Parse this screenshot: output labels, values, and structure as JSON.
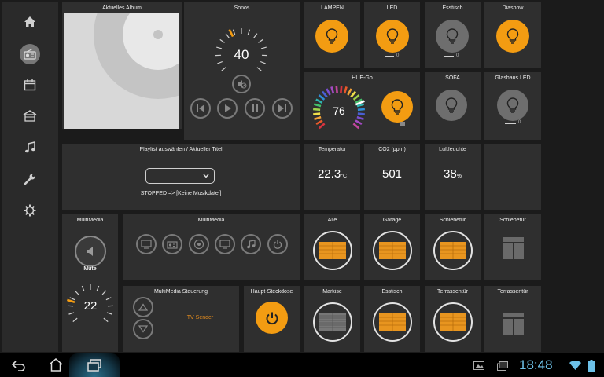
{
  "album": {
    "title": "Aktuelles Album"
  },
  "sonos": {
    "title": "Sonos",
    "volume": "40",
    "volume_level": 0.4
  },
  "playlist": {
    "title": "Playlist auswählen / Aktueller Titel",
    "selected": "",
    "status": "STOPPED => [Keine Musikdatei]"
  },
  "lights": [
    {
      "title": "LAMPEN",
      "state": "on"
    },
    {
      "title": "LED",
      "state": "on",
      "level": "0"
    },
    {
      "title": "Esstisch",
      "state": "off",
      "level": "0"
    },
    {
      "title": "Diashow",
      "state": "on"
    },
    {
      "title": "SOFA",
      "state": "off"
    },
    {
      "title": "Glashaus LED",
      "state": "off",
      "level": "0"
    }
  ],
  "hue": {
    "title": "HUE-Go",
    "value": "76",
    "level": 0.76
  },
  "sensors": [
    {
      "title": "Temperatur",
      "value": "22.3",
      "unit": "°C"
    },
    {
      "title": "CO2 (ppm)",
      "value": "501",
      "unit": ""
    },
    {
      "title": "Luftfeuchte",
      "value": "38",
      "unit": "%"
    }
  ],
  "multimedia_volume": {
    "title": "MultiMedia",
    "mute_label": "Mute",
    "value": "22",
    "level": 0.22
  },
  "multimedia_sources": {
    "title": "MultiMedia"
  },
  "multimedia_control": {
    "title": "MultiMedia Steuerung",
    "source": "TV Sender"
  },
  "main_socket": {
    "title": "Haupt-Steckdose"
  },
  "shutters": [
    {
      "title": "Alle",
      "state": "closed"
    },
    {
      "title": "Garage",
      "state": "closed"
    },
    {
      "title": "Schiebetür",
      "state": "closed"
    },
    {
      "title": "Schiebetür",
      "state": "window"
    },
    {
      "title": "Markise",
      "state": "gray"
    },
    {
      "title": "Esstisch",
      "state": "closed"
    },
    {
      "title": "Terrassentür",
      "state": "closed"
    },
    {
      "title": "Terrassentür",
      "state": "window"
    }
  ],
  "statusbar": {
    "time": "18:48"
  },
  "colors": {
    "accent": "#f39c12",
    "tile": "#2f2f2f",
    "background": "#1b1b1b",
    "text_orange": "#e08a1e"
  },
  "icons": [
    "home-icon",
    "radio-icon",
    "calendar-icon",
    "garage-icon",
    "music-note-icon",
    "wrench-icon",
    "gear-icon",
    "bulb-icon",
    "monitor-icon",
    "cd-icon",
    "speaker-icon",
    "power-icon",
    "back-icon",
    "home-nav-icon",
    "recent-apps-icon",
    "gallery-icon",
    "wifi-icon",
    "battery-icon"
  ]
}
